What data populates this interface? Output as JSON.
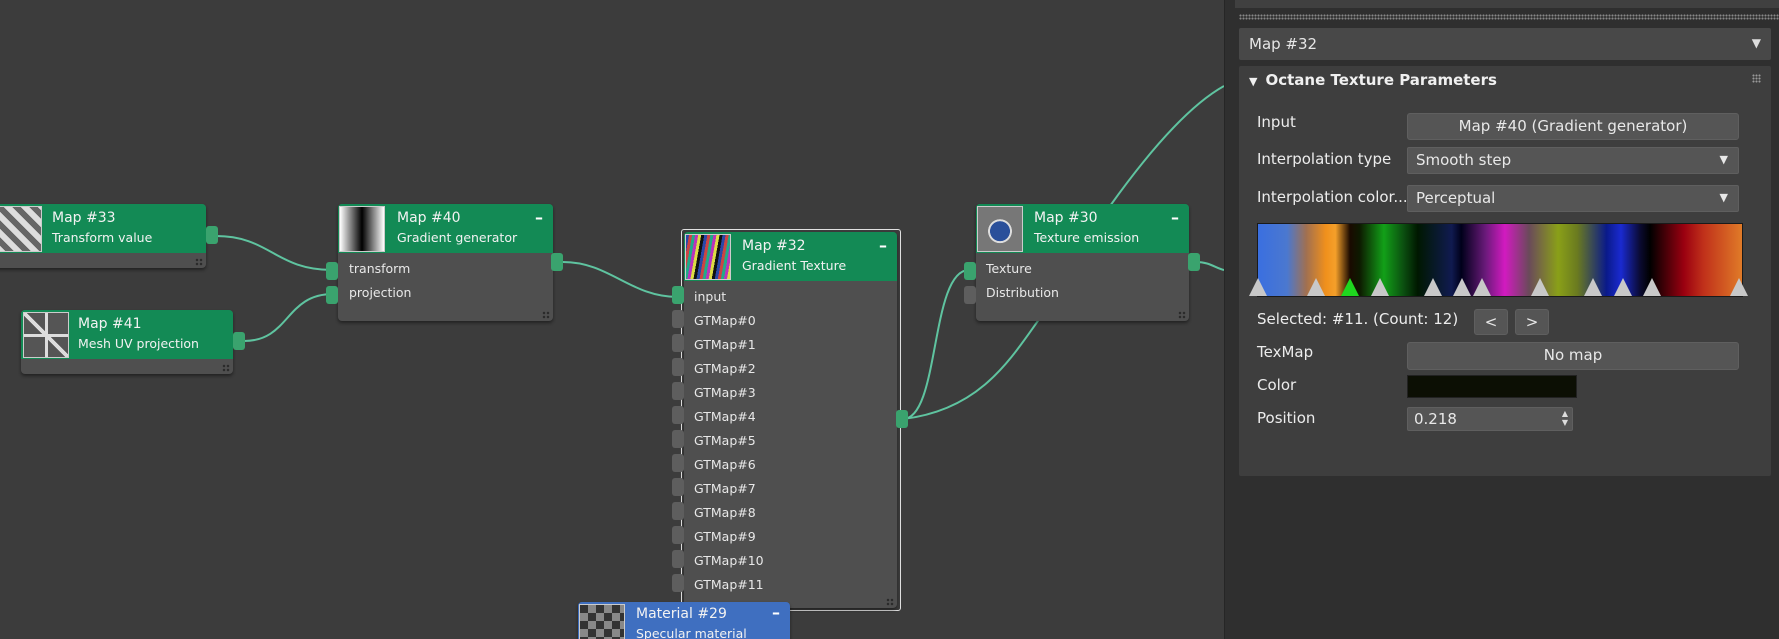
{
  "graph": {
    "nodes": [
      {
        "id": "map33",
        "title": "Map #33",
        "subtitle": "Transform value"
      },
      {
        "id": "map41",
        "title": "Map #41",
        "subtitle": "Mesh UV projection"
      },
      {
        "id": "map40",
        "title": "Map #40",
        "subtitle": "Gradient generator",
        "collapse": "–",
        "inputs": [
          "transform",
          "projection"
        ]
      },
      {
        "id": "map32",
        "title": "Map #32",
        "subtitle": "Gradient Texture",
        "collapse": "–",
        "inputs": [
          "input",
          "GTMap#0",
          "GTMap#1",
          "GTMap#2",
          "GTMap#3",
          "GTMap#4",
          "GTMap#5",
          "GTMap#6",
          "GTMap#7",
          "GTMap#8",
          "GTMap#9",
          "GTMap#10",
          "GTMap#11"
        ]
      },
      {
        "id": "map30",
        "title": "Map #30",
        "subtitle": "Texture emission",
        "collapse": "–",
        "inputs": [
          "Texture",
          "Distribution"
        ]
      },
      {
        "id": "mat29",
        "title": "Material #29",
        "subtitle": "Specular material",
        "collapse": "–"
      }
    ]
  },
  "panel": {
    "map_name": "Map #32",
    "rollout_title": "Octane Texture Parameters",
    "rollout_toggle": "▼",
    "dropdown_arrow": "▼",
    "input_label": "Input",
    "input_value": "Map #40 (Gradient generator)",
    "interp_type_label": "Interpolation type",
    "interp_type_value": "Smooth step",
    "interp_color_label": "Interpolation color...",
    "interp_color_value": "Perceptual",
    "selected_text": "Selected: #11. (Count: 12)",
    "prev_label": "<",
    "next_label": ">",
    "texmap_label": "TexMap",
    "texmap_value": "No map",
    "color_label": "Color",
    "color_value": "#0c0f04",
    "position_label": "Position",
    "position_value": "0.218",
    "gradient_stop_count": 12,
    "selected_stop": 2
  },
  "colors": {
    "node_header": "#138a55",
    "material_header": "#3f6fc0",
    "wire": "#5fc4a0",
    "port": "#3aa36e",
    "selected_stop": "#1fd61f"
  }
}
